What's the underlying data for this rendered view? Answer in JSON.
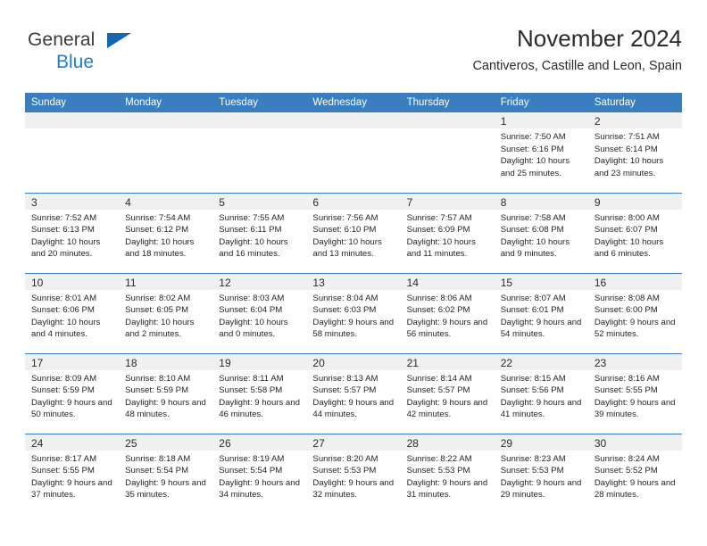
{
  "brand": {
    "line1": "General",
    "line2": "Blue",
    "triangle_color": "#1565b0",
    "text_color": "#3b3b3b",
    "blue_text_color": "#1b7fd4"
  },
  "header": {
    "title": "November 2024",
    "subtitle": "Cantiveros, Castille and Leon, Spain"
  },
  "theme": {
    "header_blue": "#3b7ebf",
    "daynum_band": "#f0f0f0",
    "row_rule": "#3b7ebf",
    "text": "#252525"
  },
  "weekday_headers": [
    "Sunday",
    "Monday",
    "Tuesday",
    "Wednesday",
    "Thursday",
    "Friday",
    "Saturday"
  ],
  "weeks": [
    [
      {
        "day": "",
        "blank": true
      },
      {
        "day": "",
        "blank": true
      },
      {
        "day": "",
        "blank": true
      },
      {
        "day": "",
        "blank": true
      },
      {
        "day": "",
        "blank": true
      },
      {
        "day": "1",
        "sunrise": "Sunrise: 7:50 AM",
        "sunset": "Sunset: 6:16 PM",
        "daylight": "Daylight: 10 hours and 25 minutes."
      },
      {
        "day": "2",
        "sunrise": "Sunrise: 7:51 AM",
        "sunset": "Sunset: 6:14 PM",
        "daylight": "Daylight: 10 hours and 23 minutes."
      }
    ],
    [
      {
        "day": "3",
        "sunrise": "Sunrise: 7:52 AM",
        "sunset": "Sunset: 6:13 PM",
        "daylight": "Daylight: 10 hours and 20 minutes."
      },
      {
        "day": "4",
        "sunrise": "Sunrise: 7:54 AM",
        "sunset": "Sunset: 6:12 PM",
        "daylight": "Daylight: 10 hours and 18 minutes."
      },
      {
        "day": "5",
        "sunrise": "Sunrise: 7:55 AM",
        "sunset": "Sunset: 6:11 PM",
        "daylight": "Daylight: 10 hours and 16 minutes."
      },
      {
        "day": "6",
        "sunrise": "Sunrise: 7:56 AM",
        "sunset": "Sunset: 6:10 PM",
        "daylight": "Daylight: 10 hours and 13 minutes."
      },
      {
        "day": "7",
        "sunrise": "Sunrise: 7:57 AM",
        "sunset": "Sunset: 6:09 PM",
        "daylight": "Daylight: 10 hours and 11 minutes."
      },
      {
        "day": "8",
        "sunrise": "Sunrise: 7:58 AM",
        "sunset": "Sunset: 6:08 PM",
        "daylight": "Daylight: 10 hours and 9 minutes."
      },
      {
        "day": "9",
        "sunrise": "Sunrise: 8:00 AM",
        "sunset": "Sunset: 6:07 PM",
        "daylight": "Daylight: 10 hours and 6 minutes."
      }
    ],
    [
      {
        "day": "10",
        "sunrise": "Sunrise: 8:01 AM",
        "sunset": "Sunset: 6:06 PM",
        "daylight": "Daylight: 10 hours and 4 minutes."
      },
      {
        "day": "11",
        "sunrise": "Sunrise: 8:02 AM",
        "sunset": "Sunset: 6:05 PM",
        "daylight": "Daylight: 10 hours and 2 minutes."
      },
      {
        "day": "12",
        "sunrise": "Sunrise: 8:03 AM",
        "sunset": "Sunset: 6:04 PM",
        "daylight": "Daylight: 10 hours and 0 minutes."
      },
      {
        "day": "13",
        "sunrise": "Sunrise: 8:04 AM",
        "sunset": "Sunset: 6:03 PM",
        "daylight": "Daylight: 9 hours and 58 minutes."
      },
      {
        "day": "14",
        "sunrise": "Sunrise: 8:06 AM",
        "sunset": "Sunset: 6:02 PM",
        "daylight": "Daylight: 9 hours and 56 minutes."
      },
      {
        "day": "15",
        "sunrise": "Sunrise: 8:07 AM",
        "sunset": "Sunset: 6:01 PM",
        "daylight": "Daylight: 9 hours and 54 minutes."
      },
      {
        "day": "16",
        "sunrise": "Sunrise: 8:08 AM",
        "sunset": "Sunset: 6:00 PM",
        "daylight": "Daylight: 9 hours and 52 minutes."
      }
    ],
    [
      {
        "day": "17",
        "sunrise": "Sunrise: 8:09 AM",
        "sunset": "Sunset: 5:59 PM",
        "daylight": "Daylight: 9 hours and 50 minutes."
      },
      {
        "day": "18",
        "sunrise": "Sunrise: 8:10 AM",
        "sunset": "Sunset: 5:59 PM",
        "daylight": "Daylight: 9 hours and 48 minutes."
      },
      {
        "day": "19",
        "sunrise": "Sunrise: 8:11 AM",
        "sunset": "Sunset: 5:58 PM",
        "daylight": "Daylight: 9 hours and 46 minutes."
      },
      {
        "day": "20",
        "sunrise": "Sunrise: 8:13 AM",
        "sunset": "Sunset: 5:57 PM",
        "daylight": "Daylight: 9 hours and 44 minutes."
      },
      {
        "day": "21",
        "sunrise": "Sunrise: 8:14 AM",
        "sunset": "Sunset: 5:57 PM",
        "daylight": "Daylight: 9 hours and 42 minutes."
      },
      {
        "day": "22",
        "sunrise": "Sunrise: 8:15 AM",
        "sunset": "Sunset: 5:56 PM",
        "daylight": "Daylight: 9 hours and 41 minutes."
      },
      {
        "day": "23",
        "sunrise": "Sunrise: 8:16 AM",
        "sunset": "Sunset: 5:55 PM",
        "daylight": "Daylight: 9 hours and 39 minutes."
      }
    ],
    [
      {
        "day": "24",
        "sunrise": "Sunrise: 8:17 AM",
        "sunset": "Sunset: 5:55 PM",
        "daylight": "Daylight: 9 hours and 37 minutes."
      },
      {
        "day": "25",
        "sunrise": "Sunrise: 8:18 AM",
        "sunset": "Sunset: 5:54 PM",
        "daylight": "Daylight: 9 hours and 35 minutes."
      },
      {
        "day": "26",
        "sunrise": "Sunrise: 8:19 AM",
        "sunset": "Sunset: 5:54 PM",
        "daylight": "Daylight: 9 hours and 34 minutes."
      },
      {
        "day": "27",
        "sunrise": "Sunrise: 8:20 AM",
        "sunset": "Sunset: 5:53 PM",
        "daylight": "Daylight: 9 hours and 32 minutes."
      },
      {
        "day": "28",
        "sunrise": "Sunrise: 8:22 AM",
        "sunset": "Sunset: 5:53 PM",
        "daylight": "Daylight: 9 hours and 31 minutes."
      },
      {
        "day": "29",
        "sunrise": "Sunrise: 8:23 AM",
        "sunset": "Sunset: 5:53 PM",
        "daylight": "Daylight: 9 hours and 29 minutes."
      },
      {
        "day": "30",
        "sunrise": "Sunrise: 8:24 AM",
        "sunset": "Sunset: 5:52 PM",
        "daylight": "Daylight: 9 hours and 28 minutes."
      }
    ]
  ]
}
